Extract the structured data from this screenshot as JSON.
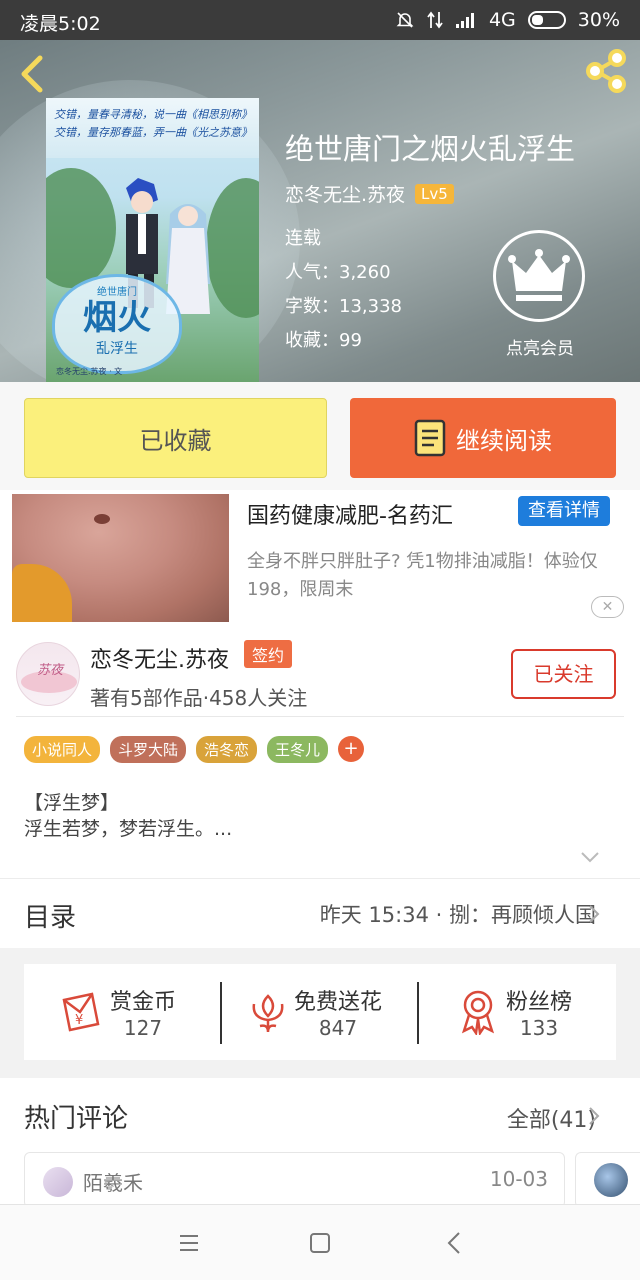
{
  "status_bar": {
    "time": "凌晨5:02",
    "network": "4G",
    "battery": "30%"
  },
  "book": {
    "title": "绝世唐门之烟火乱浮生",
    "author": "恋冬无尘.苏夜",
    "level": "Lv5",
    "status": "连载",
    "popularity": "人气：3,260",
    "word_count": "字数：13,338",
    "favorites": "收藏：99",
    "cover_text": {
      "line1": "交错，量春寻清秘，说一曲《相思别称》",
      "line2": "交错，量存那春蓝，弄一曲《光之苏意》",
      "seal_small": "绝世唐门",
      "seal_big": "烟火",
      "seal_sub": "乱浮生",
      "byline": "恋冬无尘.苏夜 · 文"
    }
  },
  "vip": {
    "label": "点亮会员"
  },
  "actions": {
    "collected_label": "已收藏",
    "read_label": "继续阅读"
  },
  "ad": {
    "title": "国药健康减肥-名药汇",
    "detail_label": "查看详情",
    "description": "全身不胖只胖肚子? 凭1物排油减脂！体验仅198，限周末",
    "close_label": "✕"
  },
  "author_card": {
    "avatar_text": "苏夜",
    "name": "恋冬无尘.苏夜",
    "sign_badge": "签约",
    "stats": "著有5部作品·458人关注",
    "follow_label": "已关注",
    "tags": [
      {
        "label": "小说同人",
        "color": "#f3b43c"
      },
      {
        "label": "斗罗大陆",
        "color": "#c0705a"
      },
      {
        "label": "浩冬恋",
        "color": "#d9a33a"
      },
      {
        "label": "王冬儿",
        "color": "#8cb860"
      }
    ],
    "tag_more": "+",
    "summary_line1": "【浮生梦】",
    "summary_line2": "浮生若梦，梦若浮生。..."
  },
  "catalog": {
    "title": "目录",
    "latest": "昨天 15:34 · 捌：再顾倾人国"
  },
  "stats": {
    "reward": {
      "label": "赏金币",
      "value": "127"
    },
    "flower": {
      "label": "免费送花",
      "value": "847"
    },
    "fans": {
      "label": "粉丝榜",
      "value": "133"
    }
  },
  "hot_comments": {
    "title": "热门评论",
    "all_label": "全部(41)",
    "first": {
      "user": "陌羲禾",
      "date": "10-03"
    }
  },
  "colors": {
    "accent_orange": "#f0683a",
    "collected_yellow": "#fbf07c",
    "follow_red": "#d93a2c",
    "ad_blue": "#1e7ddc",
    "level_badge": "#f6b63a"
  }
}
